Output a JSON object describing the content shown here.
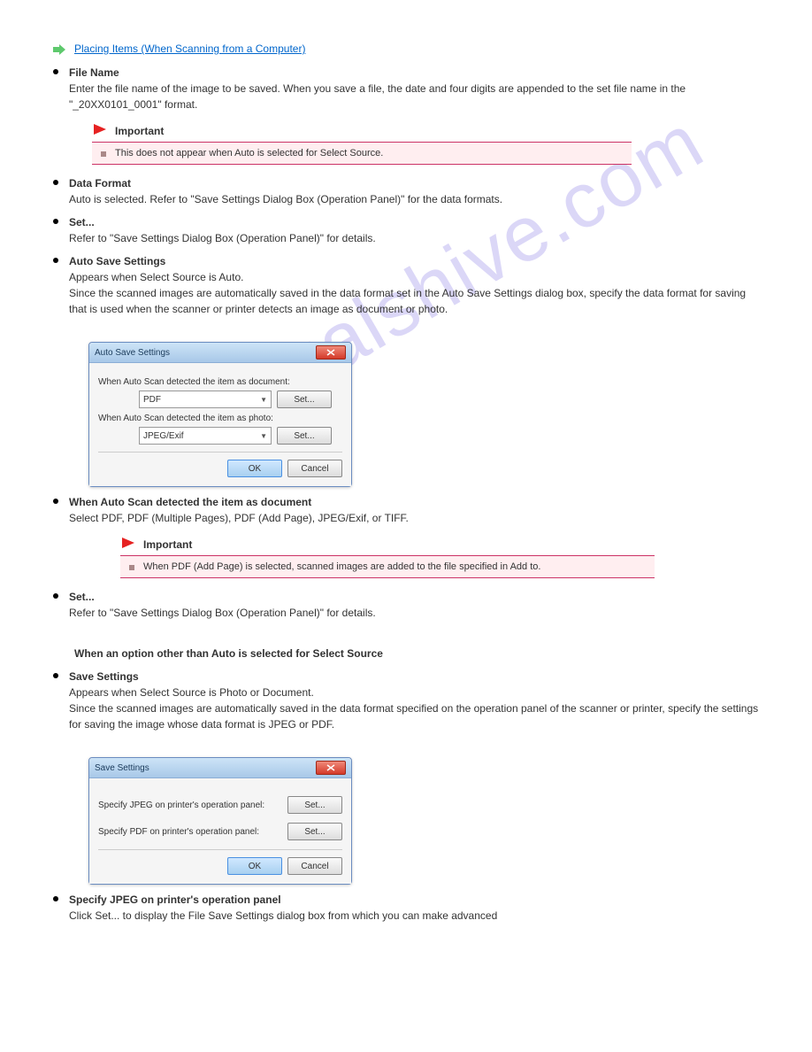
{
  "watermark": "manualshive.com",
  "link1": "Placing Items (When Scanning from a Computer)",
  "item_file": {
    "label": "File Name",
    "text": "Enter the file name of the image to be saved. When you save a file, the date and four digits are appended to the set file name in the \"_20XX0101_0001\" format."
  },
  "important_label": "Important",
  "note1": "This does not appear when Auto is selected for Select Source.",
  "item_data_format": {
    "label": "Data Format",
    "text": "Auto is selected. Refer to \"Save Settings Dialog Box (Operation Panel)\" for the data formats."
  },
  "item_set": {
    "label": "Set...",
    "text": "Refer to \"Save Settings Dialog Box (Operation Panel)\" for details."
  },
  "item_auto_save": {
    "label": "Auto Save Settings",
    "text1": "Appears when Select Source is Auto.",
    "text2": "Since the scanned images are automatically saved in the data format set in the Auto Save Settings dialog box, specify the data format for saving that is used when the scanner or printer detects an image as document or photo."
  },
  "auto_save_dialog": {
    "title": "Auto Save Settings",
    "row1_label": "When Auto Scan detected the item as document:",
    "row1_value": "PDF",
    "row2_label": "When Auto Scan detected the item as photo:",
    "row2_value": "JPEG/Exif",
    "set_btn": "Set...",
    "ok": "OK",
    "cancel": "Cancel"
  },
  "sub_item1": {
    "label": "When Auto Scan detected the item as document",
    "text": "Select PDF, PDF (Multiple Pages), PDF (Add Page), JPEG/Exif, or TIFF."
  },
  "note2": "When PDF (Add Page) is selected, scanned images are added to the file specified in Add to.",
  "sub_item2": {
    "label": "Set...",
    "text": "Refer to \"Save Settings Dialog Box (Operation Panel)\" for details."
  },
  "heading_when_not_auto": "When an option other than Auto is selected for Select Source",
  "item_save_settings": {
    "label": "Save Settings",
    "text1": "Appears when Select Source is Photo or Document.",
    "text2": "Since the scanned images are automatically saved in the data format specified on the operation panel of the scanner or printer, specify the settings for saving the image whose data format is JPEG or PDF."
  },
  "save_settings_dialog": {
    "title": "Save Settings",
    "row1_label": "Specify JPEG on printer's operation panel:",
    "row2_label": "Specify PDF on printer's operation panel:",
    "set_btn": "Set...",
    "ok": "OK",
    "cancel": "Cancel"
  },
  "sub_item3": {
    "label": "Specify JPEG on printer's operation panel",
    "text": "Click Set... to display the File Save Settings dialog box from which you can make advanced"
  }
}
